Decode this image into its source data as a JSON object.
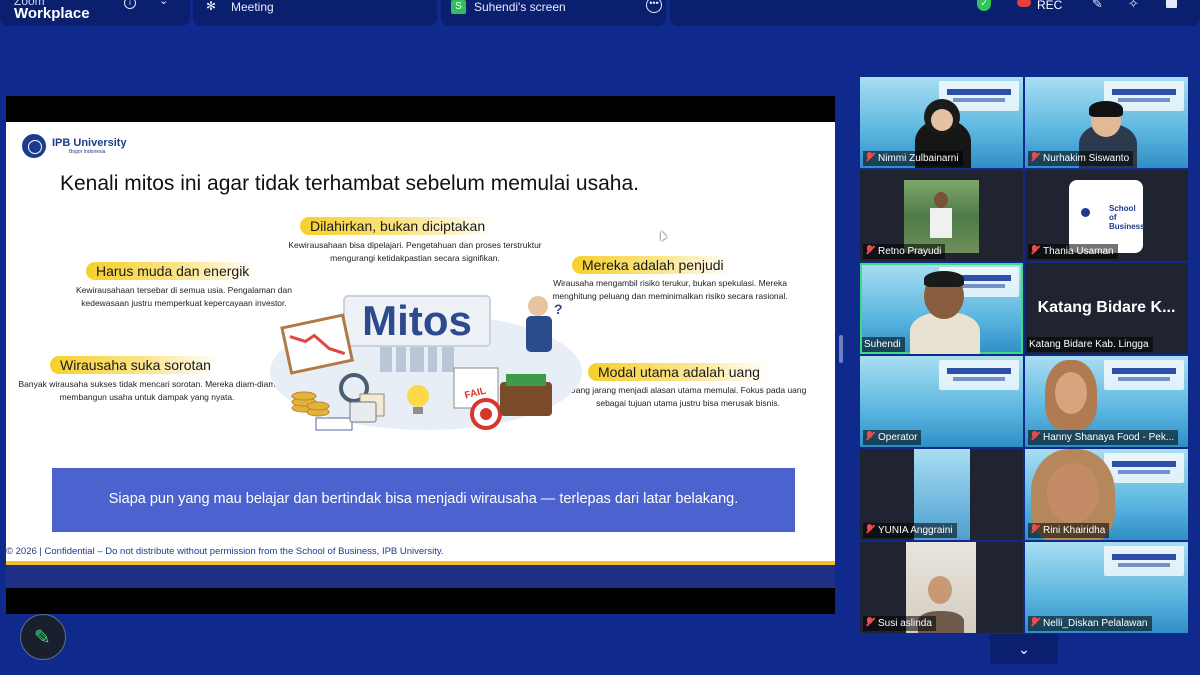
{
  "topbar": {
    "app_name_sub": "Zoom",
    "app_name": "Workplace",
    "meeting_label": "Meeting",
    "screen_badge": "S",
    "screen_label": "Suhendi's screen",
    "rec_label": "REC"
  },
  "slide": {
    "org_name": "IPB University",
    "org_sub": "Bogor Indonesia",
    "title": "Kenali mitos ini agar tidak terhambat sebelum memulai usaha.",
    "center_word": "Mitos",
    "myths": [
      {
        "label": "Dilahirkan, bukan diciptakan",
        "desc": "Kewirausahaan bisa dipelajari. Pengetahuan dan proses terstruktur mengurangi ketidakpastian secara signifikan."
      },
      {
        "label": "Harus muda dan energik",
        "desc": "Kewirausahaan tersebar di semua usia. Pengalaman dan kedewasaan justru memperkuat kepercayaan investor."
      },
      {
        "label": "Mereka adalah penjudi",
        "desc": "Wirausaha mengambil risiko terukur, bukan spekulasi. Mereka menghitung peluang dan meminimalkan risiko secara rasional."
      },
      {
        "label": "Wirausaha suka sorotan",
        "desc": "Banyak wirausaha sukses tidak mencari sorotan. Mereka diam-diam membangun usaha untuk dampak yang nyata."
      },
      {
        "label": "Modal utama adalah uang",
        "desc": "Uang jarang menjadi alasan utama memulai. Fokus pada uang sebagai tujuan utama justru bisa merusak bisnis."
      }
    ],
    "fail_text": "FAIL",
    "banner": "Siapa pun yang mau belajar dan bertindak bisa menjadi wirausaha — terlepas dari latar belakang.",
    "footer": "© 2026 | Confidential – Do not distribute without permission from the School of Business, IPB University."
  },
  "gallery": {
    "participants": [
      {
        "name": "Nimmi Zulbainarni"
      },
      {
        "name": "Nurhakim Siswanto"
      },
      {
        "name": "Retno Prayudi"
      },
      {
        "name": "Thania Usaman"
      },
      {
        "name": "Suhendi"
      },
      {
        "name": "Katang Bidare Kab. Lingga"
      },
      {
        "name": "Operator"
      },
      {
        "name": "Hanny Shanaya Food - Pek..."
      },
      {
        "name": "YUNIA Anggraini"
      },
      {
        "name": "Rini Khairidha"
      },
      {
        "name": "Susi aslinda"
      },
      {
        "name": "Nelli_Diskan Pelalawan"
      }
    ],
    "big_name_display": "Katang Bidare K...",
    "school_logo_text": "School of Business"
  },
  "colors": {
    "background": "#0f2a8c",
    "accent_yellow": "#f6d02a",
    "banner": "#4b62cf",
    "active_speaker": "#3ddc84",
    "mic_off": "#ef4b4b"
  }
}
